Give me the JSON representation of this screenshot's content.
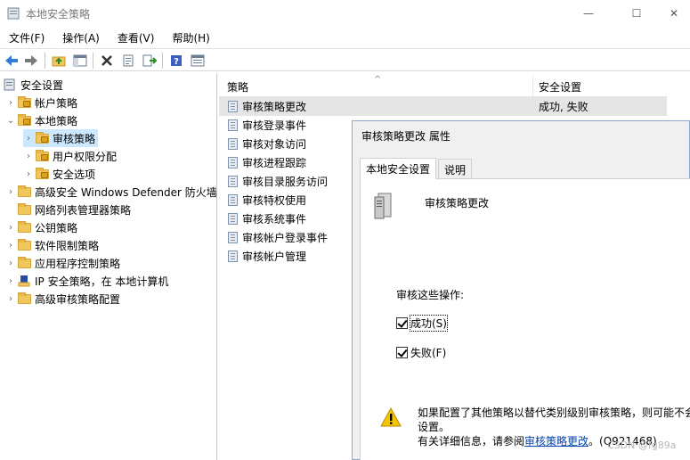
{
  "window": {
    "title": "本地安全策略",
    "minimize": "—",
    "maximize": "☐",
    "close": "✕"
  },
  "menu": [
    "文件(F)",
    "操作(A)",
    "查看(V)",
    "帮助(H)"
  ],
  "tree": {
    "root": "安全设置",
    "items": [
      {
        "label": "帐户策略"
      },
      {
        "label": "本地策略"
      },
      {
        "label": "审核策略"
      },
      {
        "label": "用户权限分配"
      },
      {
        "label": "安全选项"
      },
      {
        "label": "高级安全 Windows Defender 防火墙"
      },
      {
        "label": "网络列表管理器策略"
      },
      {
        "label": "公钥策略"
      },
      {
        "label": "软件限制策略"
      },
      {
        "label": "应用程序控制策略"
      },
      {
        "label": "IP 安全策略，在 本地计算机"
      },
      {
        "label": "高级审核策略配置"
      }
    ]
  },
  "list": {
    "col_policy": "策略",
    "col_setting": "安全设置",
    "rows": [
      {
        "policy": "审核策略更改",
        "setting": "成功, 失败"
      },
      {
        "policy": "审核登录事件",
        "setting": ""
      },
      {
        "policy": "审核对象访问",
        "setting": ""
      },
      {
        "policy": "审核进程跟踪",
        "setting": ""
      },
      {
        "policy": "审核目录服务访问",
        "setting": ""
      },
      {
        "policy": "审核特权使用",
        "setting": ""
      },
      {
        "policy": "审核系统事件",
        "setting": ""
      },
      {
        "policy": "审核帐户登录事件",
        "setting": ""
      },
      {
        "policy": "审核帐户管理",
        "setting": ""
      }
    ]
  },
  "dialog": {
    "title": "审核策略更改 属性",
    "tabs": [
      "本地安全设置",
      "说明"
    ],
    "policy_name": "审核策略更改",
    "ops_label": "审核这些操作:",
    "success_label": "成功(S)",
    "success_checked": true,
    "failure_label": "失败(F)",
    "failure_checked": true,
    "warning_line1": "如果配置了其他策略以替代类别级别审核策略，则可能不会",
    "warning_line2": "设置。",
    "warning_line3_prefix": "有关详细信息，请参阅",
    "warning_link": "审核策略更改",
    "warning_suffix": "。(Q921468)"
  },
  "watermark": "CSDN @fg89a"
}
